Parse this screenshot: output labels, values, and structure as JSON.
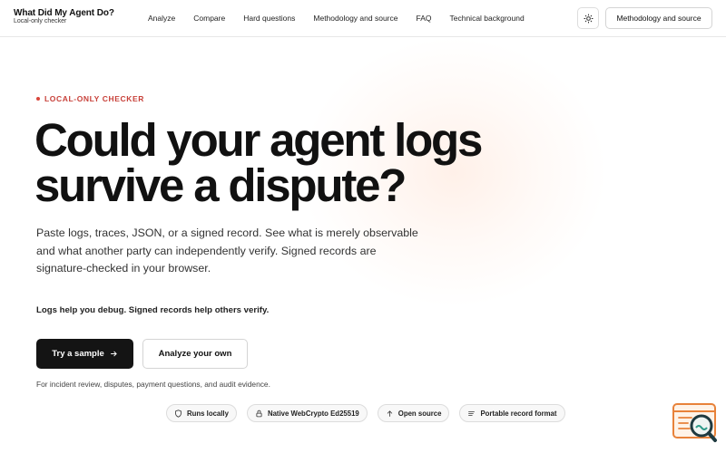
{
  "brand": {
    "title": "What Did My Agent Do?",
    "subtitle": "Local-only checker"
  },
  "nav": {
    "items": [
      "Analyze",
      "Compare",
      "Hard questions",
      "Methodology and source",
      "FAQ",
      "Technical background"
    ]
  },
  "header": {
    "theme_icon": "sun-icon",
    "cta_label": "Methodology and source"
  },
  "hero": {
    "eyebrow": "LOCAL-ONLY CHECKER",
    "headline_line1": "Could your agent logs",
    "headline_line2": "survive a dispute?",
    "lead_line1": "Paste logs, traces, JSON, or a signed record. See what is merely observable",
    "lead_line2": "and what another party can independently verify. Signed records are",
    "lead_line3": "signature-checked in your browser.",
    "tagline": "Logs help you debug. Signed records help others verify.",
    "primary_button": "Try a sample",
    "secondary_button": "Analyze your own",
    "footnote": "For incident review, disputes, payment questions, and audit evidence."
  },
  "pills": [
    {
      "label": "Runs locally",
      "icon": "shield-icon"
    },
    {
      "label": "Native WebCrypto Ed25519",
      "icon": "lock-icon"
    },
    {
      "label": "Open source",
      "icon": "arrow-up-icon"
    },
    {
      "label": "Portable record format",
      "icon": "lines-icon"
    }
  ],
  "colors": {
    "accent": "#c8413a",
    "primary_button_bg": "#141414",
    "widget_accent": "#e8823a"
  }
}
